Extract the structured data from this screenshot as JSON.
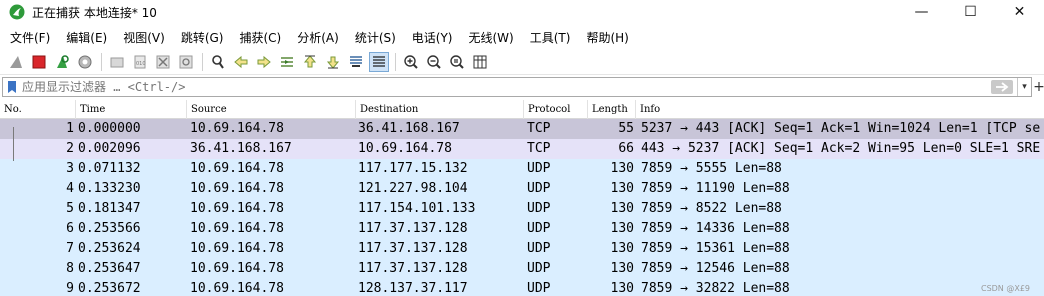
{
  "window": {
    "title": "正在捕获 本地连接* 10",
    "controls": {
      "minimize": "—",
      "maximize": "☐",
      "close": "✕"
    }
  },
  "menu": [
    "文件(F)",
    "编辑(E)",
    "视图(V)",
    "跳转(G)",
    "捕获(C)",
    "分析(A)",
    "统计(S)",
    "电话(Y)",
    "无线(W)",
    "工具(T)",
    "帮助(H)"
  ],
  "toolbar": {
    "icons": [
      "shark-fin-start-icon",
      "stop-capture-icon",
      "restart-capture-icon",
      "capture-options-icon",
      "open-file-icon",
      "save-file-icon",
      "close-file-icon",
      "reload-file-icon",
      "find-packet-icon",
      "go-back-icon",
      "go-forward-icon",
      "go-to-packet-icon",
      "go-first-icon",
      "go-last-icon",
      "auto-scroll-icon",
      "colorize-icon",
      "zoom-in-icon",
      "zoom-out-icon",
      "zoom-normal-icon",
      "resize-columns-icon"
    ]
  },
  "filter": {
    "placeholder": "应用显示过滤器 … <Ctrl-/>"
  },
  "columns": {
    "no": "No.",
    "time": "Time",
    "source": "Source",
    "destination": "Destination",
    "protocol": "Protocol",
    "length": "Length",
    "info": "Info"
  },
  "colors": {
    "row_tcp_selected": "#c8c5d8",
    "row_tcp": "#e5e2f8",
    "row_udp": "#daeeff",
    "accent": "#7aa9d6"
  },
  "packets": [
    {
      "no": "1",
      "time": "0.000000",
      "source": "10.69.164.78",
      "destination": "36.41.168.167",
      "protocol": "TCP",
      "length": "55",
      "info": "5237 → 443 [ACK] Seq=1 Ack=1 Win=1024 Len=1 [TCP se",
      "color": "row_tcp_selected"
    },
    {
      "no": "2",
      "time": "0.002096",
      "source": "36.41.168.167",
      "destination": "10.69.164.78",
      "protocol": "TCP",
      "length": "66",
      "info": "443 → 5237 [ACK] Seq=1 Ack=2 Win=95 Len=0 SLE=1 SRE",
      "color": "row_tcp"
    },
    {
      "no": "3",
      "time": "0.071132",
      "source": "10.69.164.78",
      "destination": "117.177.15.132",
      "protocol": "UDP",
      "length": "130",
      "info": "7859 → 5555 Len=88",
      "color": "row_udp"
    },
    {
      "no": "4",
      "time": "0.133230",
      "source": "10.69.164.78",
      "destination": "121.227.98.104",
      "protocol": "UDP",
      "length": "130",
      "info": "7859 → 11190 Len=88",
      "color": "row_udp"
    },
    {
      "no": "5",
      "time": "0.181347",
      "source": "10.69.164.78",
      "destination": "117.154.101.133",
      "protocol": "UDP",
      "length": "130",
      "info": "7859 → 8522 Len=88",
      "color": "row_udp"
    },
    {
      "no": "6",
      "time": "0.253566",
      "source": "10.69.164.78",
      "destination": "117.37.137.128",
      "protocol": "UDP",
      "length": "130",
      "info": "7859 → 14336 Len=88",
      "color": "row_udp"
    },
    {
      "no": "7",
      "time": "0.253624",
      "source": "10.69.164.78",
      "destination": "117.37.137.128",
      "protocol": "UDP",
      "length": "130",
      "info": "7859 → 15361 Len=88",
      "color": "row_udp"
    },
    {
      "no": "8",
      "time": "0.253647",
      "source": "10.69.164.78",
      "destination": "117.37.137.128",
      "protocol": "UDP",
      "length": "130",
      "info": "7859 → 12546 Len=88",
      "color": "row_udp"
    },
    {
      "no": "9",
      "time": "0.253672",
      "source": "10.69.164.78",
      "destination": "128.137.37.117",
      "protocol": "UDP",
      "length": "130",
      "info": "7859 → 32822 Len=88",
      "color": "row_udp"
    }
  ],
  "watermark": "CSDN @X£9"
}
